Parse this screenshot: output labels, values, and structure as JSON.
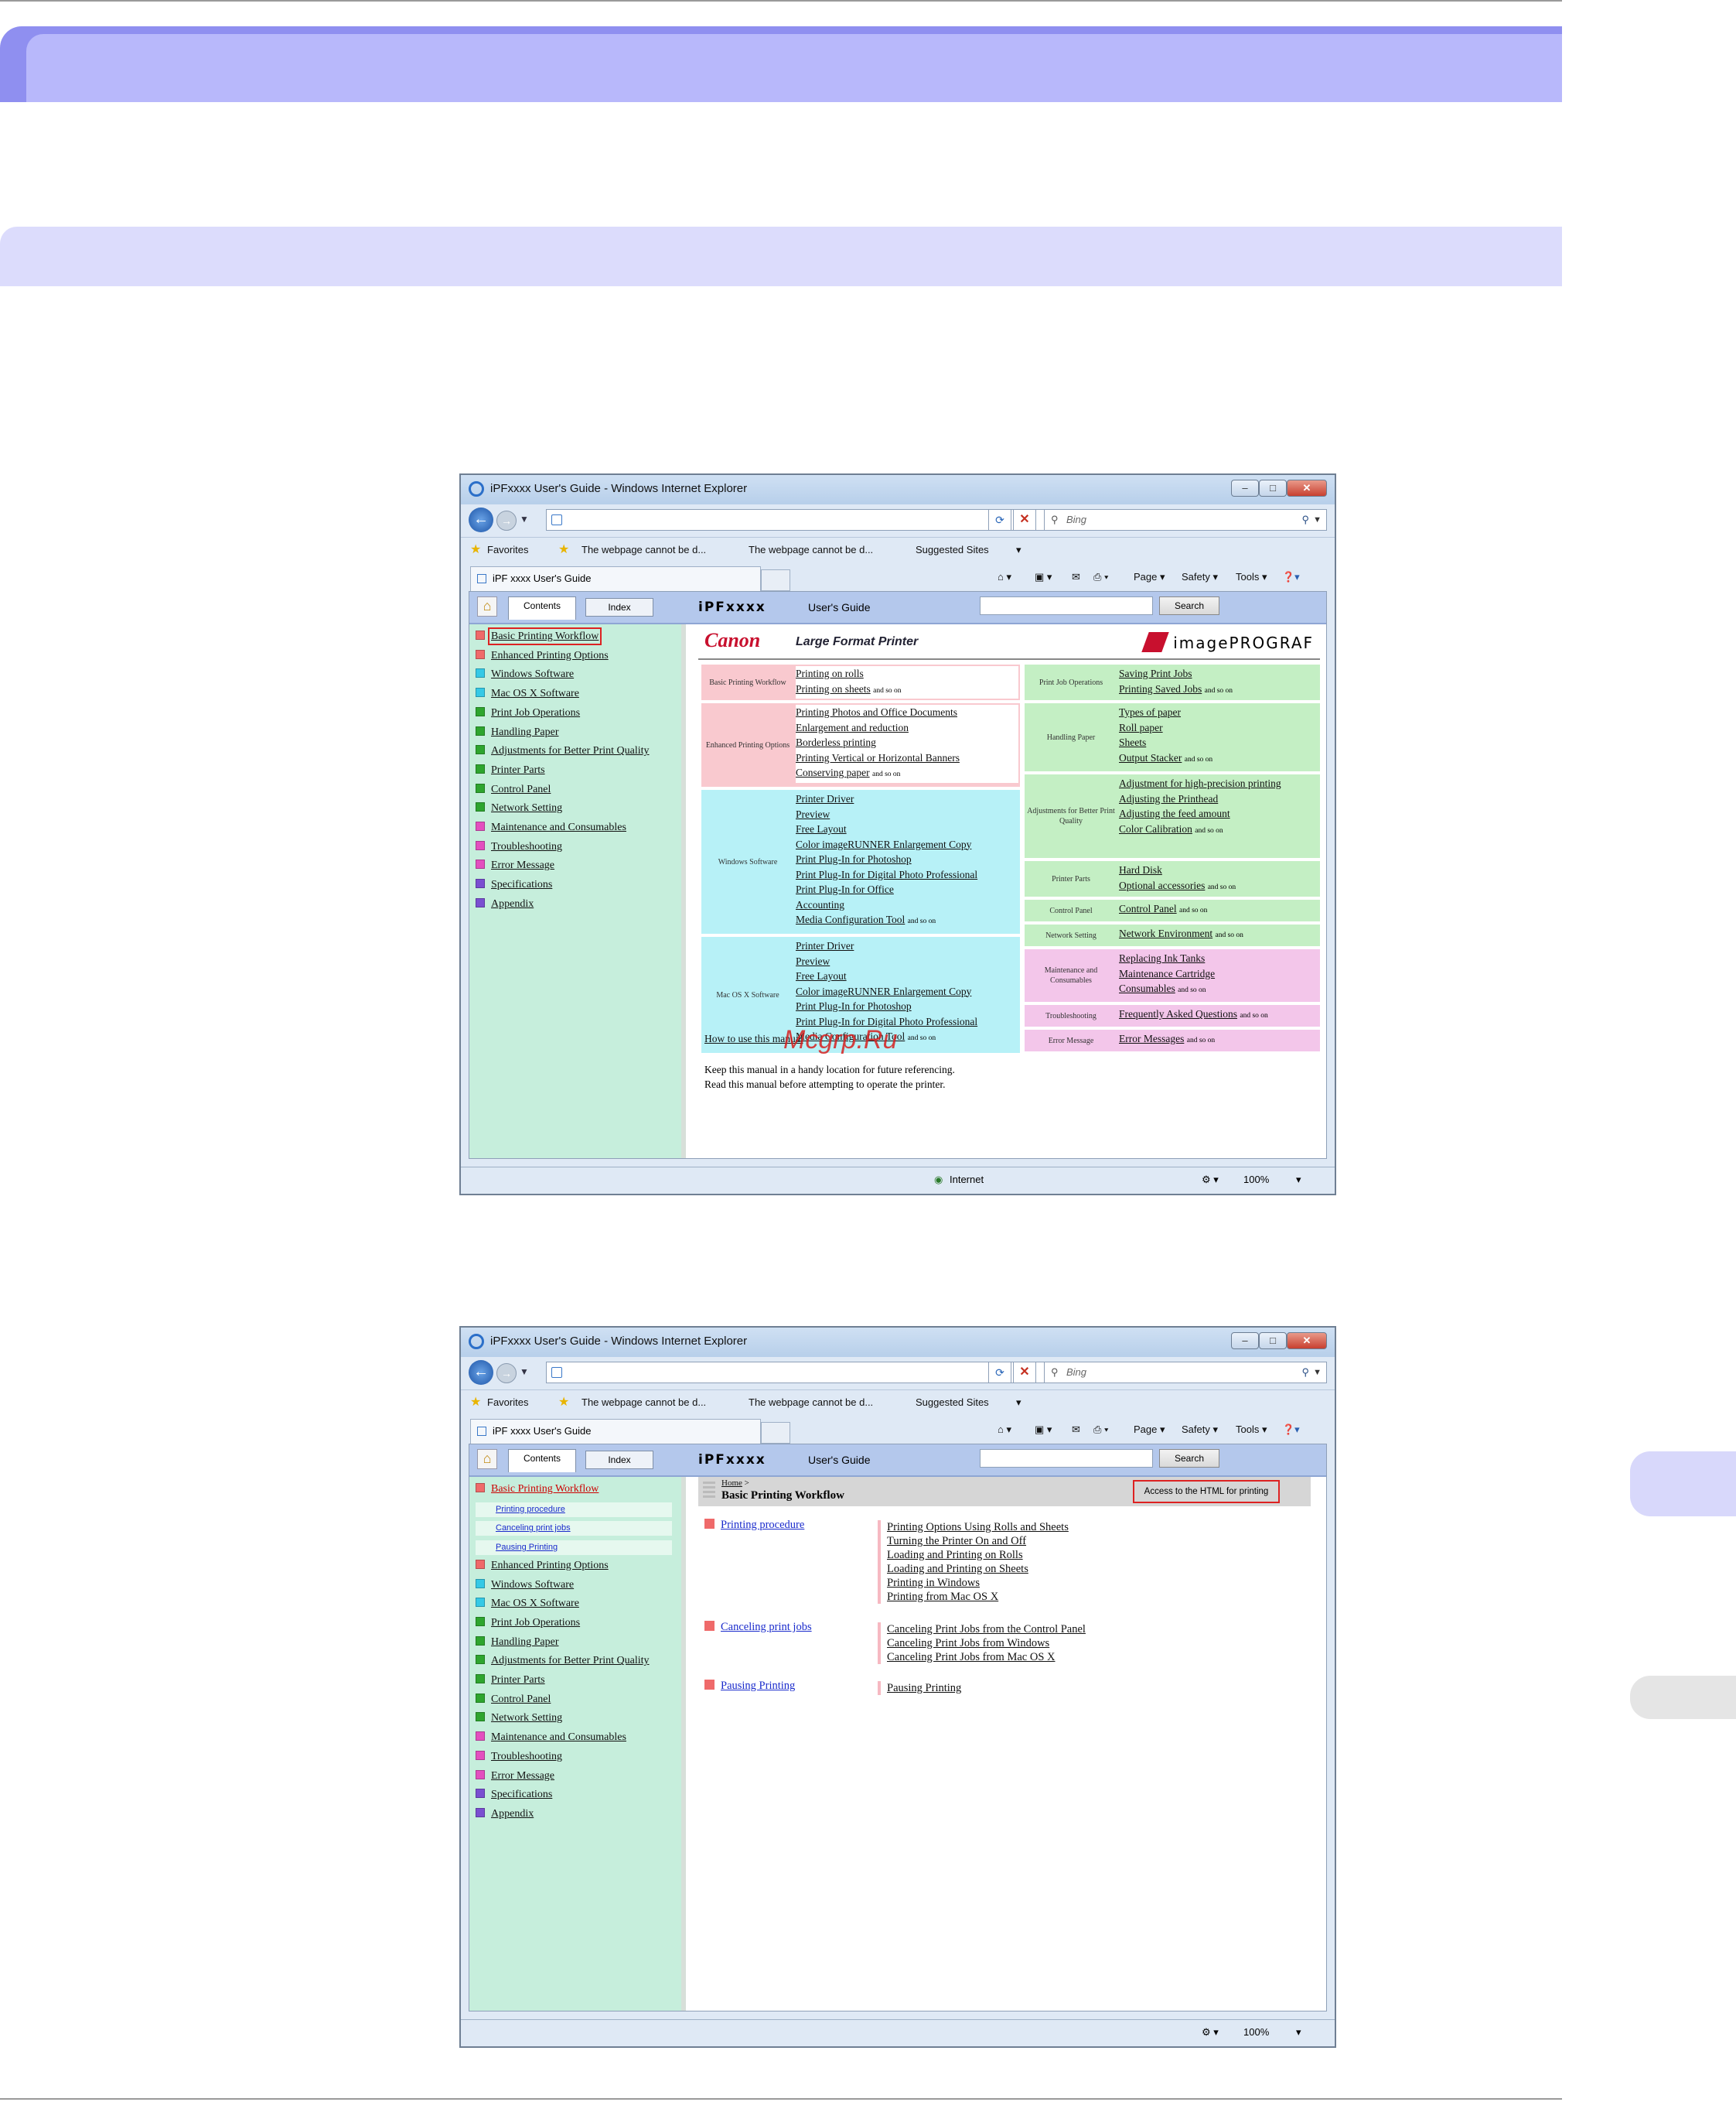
{
  "window": {
    "title": "iPFxxxx  User's Guide - Windows Internet Explorer",
    "search_placeholder": "Bing",
    "favorites_label": "Favorites",
    "fav_items": [
      "The webpage cannot be d...",
      "The webpage cannot be d...",
      "Suggested Sites"
    ],
    "tab_title": "iPF xxxx  User's Guide",
    "commands": [
      "Page",
      "Safety",
      "Tools"
    ],
    "status_zone": "Internet",
    "zoom": "100%"
  },
  "guide": {
    "tab_contents": "Contents",
    "tab_index": "Index",
    "model": "iPFxxxx",
    "title": "User's Guide",
    "search_button": "Search",
    "brand": "Canon",
    "tagline": "Large Format Printer",
    "product_logo": "imagePROGRAF"
  },
  "nav": [
    {
      "label": "Basic Printing Workflow",
      "color": "red"
    },
    {
      "label": "Enhanced Printing Options",
      "color": "red"
    },
    {
      "label": "Windows Software",
      "color": "cyan"
    },
    {
      "label": "Mac OS X Software",
      "color": "cyan"
    },
    {
      "label": "Print Job Operations",
      "color": "green"
    },
    {
      "label": "Handling Paper",
      "color": "green"
    },
    {
      "label": "Adjustments for Better Print Quality",
      "color": "green"
    },
    {
      "label": "Printer Parts",
      "color": "green"
    },
    {
      "label": "Control Panel",
      "color": "green"
    },
    {
      "label": "Network Setting",
      "color": "green"
    },
    {
      "label": "Maintenance and Consumables",
      "color": "pink"
    },
    {
      "label": "Troubleshooting",
      "color": "pink"
    },
    {
      "label": "Error Message",
      "color": "pink"
    },
    {
      "label": "Specifications",
      "color": "purple"
    },
    {
      "label": "Appendix",
      "color": "purple"
    }
  ],
  "subnav": [
    "Printing procedure",
    "Canceling print jobs",
    "Pausing Printing"
  ],
  "left_cells": [
    {
      "label": "Basic Printing Workflow",
      "links": [
        "Printing on rolls",
        "Printing on sheets"
      ],
      "color": "red"
    },
    {
      "label": "Enhanced Printing Options",
      "links": [
        "Printing Photos and Office Documents",
        "Enlargement and reduction",
        "Borderless printing",
        "Printing Vertical or Horizontal Banners",
        "Conserving paper"
      ],
      "color": "red"
    },
    {
      "label": "Windows Software",
      "links": [
        "Printer Driver",
        "Preview",
        "Free Layout",
        "Color imageRUNNER Enlargement Copy",
        "Print Plug-In for Photoshop",
        "Print Plug-In for Digital Photo Professional",
        "Print Plug-In for Office",
        "Accounting",
        "Media Configuration Tool"
      ],
      "color": "cyan"
    },
    {
      "label": "Mac OS X Software",
      "links": [
        "Printer Driver",
        "Preview",
        "Free Layout",
        "Color imageRUNNER Enlargement Copy",
        "Print Plug-In for Photoshop",
        "Print Plug-In for Digital Photo Professional",
        "Media Configuration Tool"
      ],
      "color": "cyan"
    }
  ],
  "right_cells": [
    {
      "label": "Print Job Operations",
      "links": [
        "Saving Print Jobs",
        "Printing Saved Jobs"
      ],
      "color": "green"
    },
    {
      "label": "Handling Paper",
      "links": [
        "Types of paper",
        "Roll paper",
        "Sheets",
        "Output Stacker"
      ],
      "color": "green"
    },
    {
      "label": "Adjustments for Better Print Quality",
      "links": [
        "Adjustment for high-precision printing",
        "Adjusting the Printhead",
        "Adjusting the feed amount",
        "Color Calibration"
      ],
      "color": "green"
    },
    {
      "label": "Printer Parts",
      "links": [
        "Hard Disk",
        "Optional accessories"
      ],
      "color": "green"
    },
    {
      "label": "Control Panel",
      "links": [
        "Control Panel"
      ],
      "color": "green"
    },
    {
      "label": "Network Setting",
      "links": [
        "Network Environment"
      ],
      "color": "green"
    },
    {
      "label": "Maintenance and Consumables",
      "links": [
        "Replacing Ink Tanks",
        "Maintenance Cartridge",
        "Consumables"
      ],
      "color": "pink"
    },
    {
      "label": "Troubleshooting",
      "links": [
        "Frequently Asked Questions"
      ],
      "color": "pink"
    },
    {
      "label": "Error Message",
      "links": [
        "Error Messages"
      ],
      "color": "pink"
    }
  ],
  "and_so_on": "and so on",
  "how_to": "How to use this manual",
  "note_lines": [
    "Keep this manual in a handy location for future referencing.",
    "Read this manual before attempting to operate the printer."
  ],
  "watermark": "Mcgrp.Ru",
  "page2": {
    "crumb_home": "Home",
    "crumb_sep": ">",
    "title": "Basic Printing Workflow",
    "print_link": "Access to the HTML for printing",
    "sections": [
      {
        "title": "Printing procedure",
        "links": [
          "Printing Options Using Rolls and Sheets",
          "Turning the Printer On and Off",
          "Loading and Printing on Rolls",
          "Loading and Printing on Sheets",
          "Printing in Windows",
          "Printing from Mac OS X"
        ]
      },
      {
        "title": "Canceling print jobs",
        "links": [
          "Canceling Print Jobs from the Control Panel",
          "Canceling Print Jobs from Windows",
          "Canceling Print Jobs from Mac OS X"
        ]
      },
      {
        "title": "Pausing Printing",
        "links": [
          "Pausing Printing"
        ]
      }
    ]
  }
}
